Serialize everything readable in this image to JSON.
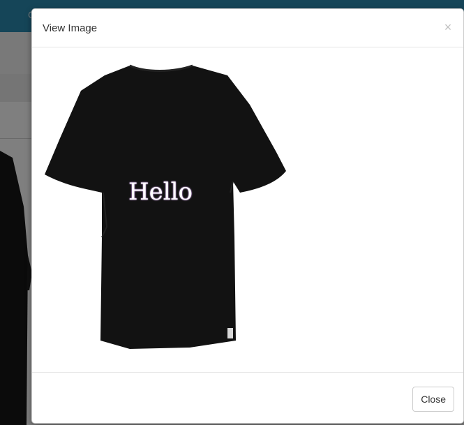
{
  "background_page": {
    "topbar_text": "C",
    "chevron_icon": "chevron-right-icon"
  },
  "modal": {
    "title": "View Image",
    "close_icon": "×",
    "footer": {
      "close_label": "Close"
    },
    "image": {
      "shirt_text": "Hello",
      "shirt_color": "#121212",
      "text_color": "#ffffff"
    }
  }
}
